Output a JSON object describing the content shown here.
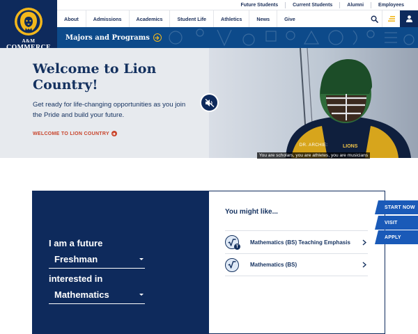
{
  "logo": {
    "line1": "A&M",
    "line2": "COMMERCE"
  },
  "utility_nav": [
    "Future Students",
    "Current Students",
    "Alumni",
    "Employees"
  ],
  "main_nav": [
    "About",
    "Admissions",
    "Academics",
    "Student Life",
    "Athletics",
    "News",
    "Give"
  ],
  "icons": {
    "search": "search-icon",
    "menu": "menu-icon",
    "user": "user-icon"
  },
  "majors_banner": {
    "label": "Majors and Programs"
  },
  "hero": {
    "title": "Welcome to Lion Country!",
    "subtitle": "Get ready for life-changing opportunities as you join the Pride and build your future.",
    "link": "WELCOME TO LION COUNTRY",
    "video": {
      "caption_speaker": "DR. ARCHIE:",
      "caption_text": "You are scholars, you are athletes, you are musicians",
      "jersey_text": "LIONS"
    }
  },
  "finder": {
    "line1": "I am a future",
    "student_type": "Freshman",
    "line2": "interested in",
    "subject": "Mathematics"
  },
  "suggestions": {
    "title": "You might like...",
    "items": [
      {
        "label": "Mathematics (BS) Teaching Emphasis",
        "badge": "T"
      },
      {
        "label": "Mathematics (BS)",
        "badge": ""
      }
    ]
  },
  "cta": {
    "start_now": "START NOW",
    "visit": "VISIT",
    "apply": "APPLY"
  },
  "colors": {
    "navy": "#0e2a5c",
    "gold": "#f2b71c",
    "blue": "#1a5ab8",
    "accent_red": "#c8432a"
  }
}
